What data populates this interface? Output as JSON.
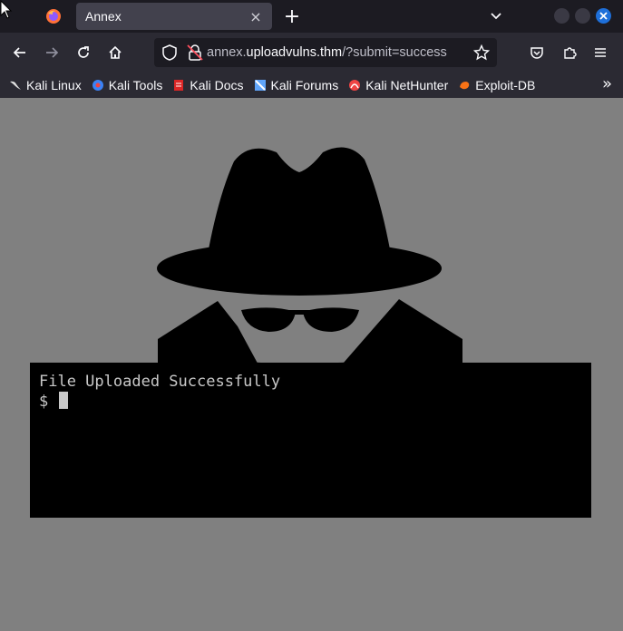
{
  "tabs": {
    "active_title": "Annex",
    "close_symbol": "×",
    "new_tab_symbol": "+"
  },
  "urlbar": {
    "prefix": "annex.",
    "host": "uploadvulns.thm",
    "suffix": "/?submit=success"
  },
  "bookmarks": [
    {
      "label": "Kali Linux",
      "icon": "kali-dragon-icon",
      "color": "#e0e0e0"
    },
    {
      "label": "Kali Tools",
      "icon": "kali-tools-icon",
      "color": "#3b82f6"
    },
    {
      "label": "Kali Docs",
      "icon": "kali-docs-icon",
      "color": "#dc2626"
    },
    {
      "label": "Kali Forums",
      "icon": "kali-forums-icon",
      "color": "#60a5fa"
    },
    {
      "label": "Kali NetHunter",
      "icon": "kali-nethunter-icon",
      "color": "#ef4444"
    },
    {
      "label": "Exploit-DB",
      "icon": "exploit-db-icon",
      "color": "#f97316"
    }
  ],
  "page": {
    "background": "#808080",
    "terminal": {
      "line1": "File Uploaded Successfully",
      "prompt": "$ "
    }
  },
  "colors": {
    "accent": "#1e6fd9",
    "chrome_dark": "#1c1b22",
    "chrome": "#2b2a33"
  }
}
